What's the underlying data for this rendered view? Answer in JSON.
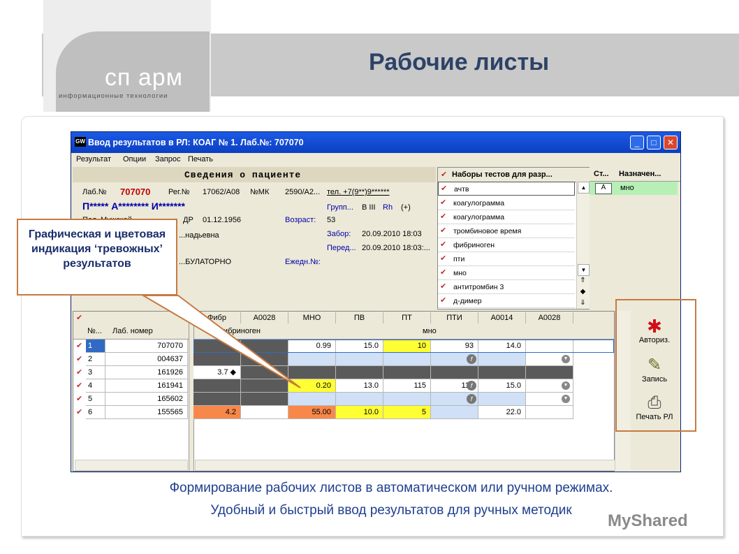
{
  "slide": {
    "title": "Рабочие листы",
    "logo_text": "сп арм",
    "logo_subtitle": "информационные технологии",
    "caption_line1": "Формирование рабочих листов в автоматическом или ручном режимах.",
    "caption_line2": "Удобный и быстрый ввод результатов для ручных методик",
    "watermark": "MyShared",
    "callout": "Графическая и цветовая индикация ‘тревожных’ результатов"
  },
  "window": {
    "title": "Ввод результатов в РЛ: КОАГ № 1. Лаб.№: 707070",
    "app_icon": "GW",
    "menu": [
      "Результат",
      "Опции",
      "Запрос",
      "Печать"
    ]
  },
  "patient": {
    "header": "Сведения о пациенте",
    "lab_label": "Лаб.№",
    "lab_value": "707070",
    "reg_label": "Рег.№",
    "reg_value": "17062/А08",
    "mk_label": "№МК",
    "mk_value": "2590/А2...",
    "phone": "тел. +7(9**)9******",
    "name": "П***** А******** И*******",
    "group_label": "Групп...",
    "group_value": "B III",
    "rh_label": "Rh",
    "rh_value": "(+)",
    "sex_label": "Пол",
    "sex_value": "Мужской",
    "dob_label": "ДР",
    "dob_value": "01.12.1956",
    "age_label": "Возраст:",
    "age_value": "53",
    "patronymic": "...надьевна",
    "sample_label": "Забор:",
    "sample_value": "20.09.2010 18:03",
    "sent_label": "Перед...",
    "sent_value": "20.09.2010 18:03:...",
    "dept_value": "...БУЛАТОРНО",
    "daily_label": "Ежедн.№:"
  },
  "tests": {
    "header": "Наборы тестов для разр...",
    "items": [
      "ачтв",
      "коагулограмма",
      "коагулограмма",
      "тромбиновое время",
      "фибриноген",
      "пти",
      "мно",
      "антитромбин 3",
      "д-димер"
    ]
  },
  "assign": {
    "col1": "Ст...",
    "col2": "Назначен...",
    "status": "А",
    "value": "мно"
  },
  "grid": {
    "left_headers": [
      "№...",
      "Лаб. номер"
    ],
    "top_headers": [
      "Фибр",
      "А0028",
      "МНО",
      "ПВ",
      "ПТ",
      "ПТИ",
      "А0014",
      "А0028"
    ],
    "group_headers": [
      "фибриноген",
      "мно"
    ],
    "rows": [
      {
        "n": "1",
        "lab": "707070",
        "cells": [
          "",
          "",
          "0.99",
          "15.0",
          "10",
          "93",
          "14.0",
          ""
        ]
      },
      {
        "n": "2",
        "lab": "004637",
        "cells": [
          "",
          "",
          "",
          "",
          "",
          "",
          "",
          ""
        ]
      },
      {
        "n": "3",
        "lab": "161926",
        "cells": [
          "3.7 ◆",
          "",
          "",
          "",
          "",
          "",
          "",
          ""
        ]
      },
      {
        "n": "4",
        "lab": "161941",
        "cells": [
          "",
          "",
          "0.20",
          "13.0",
          "115",
          "115",
          "15.0",
          ""
        ]
      },
      {
        "n": "5",
        "lab": "165602",
        "cells": [
          "",
          "",
          "",
          "",
          "",
          "",
          "",
          ""
        ]
      },
      {
        "n": "6",
        "lab": "155565",
        "cells": [
          "4.2",
          "",
          "55.00",
          "10.0",
          "5",
          "",
          "22.0",
          ""
        ]
      }
    ]
  },
  "toolbar": {
    "authorize": "Авториз.",
    "save": "Запись",
    "print": "Печать РЛ"
  },
  "colors": {
    "title": "#2d4266",
    "alert_yellow": "#ffff33",
    "alert_orange": "#f7884a",
    "dark_cell": "#5a5a5a",
    "blue_cell": "#cfe0f7",
    "callout_border": "#c77a42"
  }
}
